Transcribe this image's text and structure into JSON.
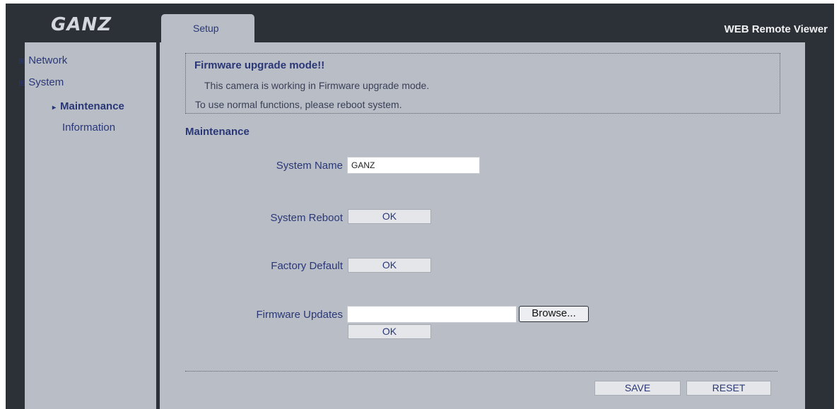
{
  "header": {
    "logo": "GANZ",
    "tab_label": "Setup",
    "app_title": "WEB Remote Viewer"
  },
  "sidebar": {
    "items": [
      {
        "label": "Network",
        "bullet": "⊞"
      },
      {
        "label": "System",
        "bullet": "⊞"
      },
      {
        "label": "Maintenance",
        "arrow": "▸"
      },
      {
        "label": "Information"
      }
    ]
  },
  "notice": {
    "title": "Firmware upgrade mode!!",
    "line1": "This camera is working in Firmware upgrade mode.",
    "line2": "To use normal functions, please reboot system."
  },
  "main": {
    "section_title": "Maintenance",
    "system_name_label": "System Name",
    "system_name_value": "GANZ",
    "system_reboot_label": "System Reboot",
    "system_reboot_button": "OK",
    "factory_default_label": "Factory Default",
    "factory_default_button": "OK",
    "firmware_updates_label": "Firmware Updates",
    "firmware_file_value": "",
    "browse_button": "Browse...",
    "firmware_ok_button": "OK"
  },
  "footer": {
    "save_button": "SAVE",
    "reset_button": "RESET"
  },
  "colors": {
    "frame": "#2c3037",
    "panel": "#b8bdc6",
    "text_primary": "#2a3777"
  }
}
